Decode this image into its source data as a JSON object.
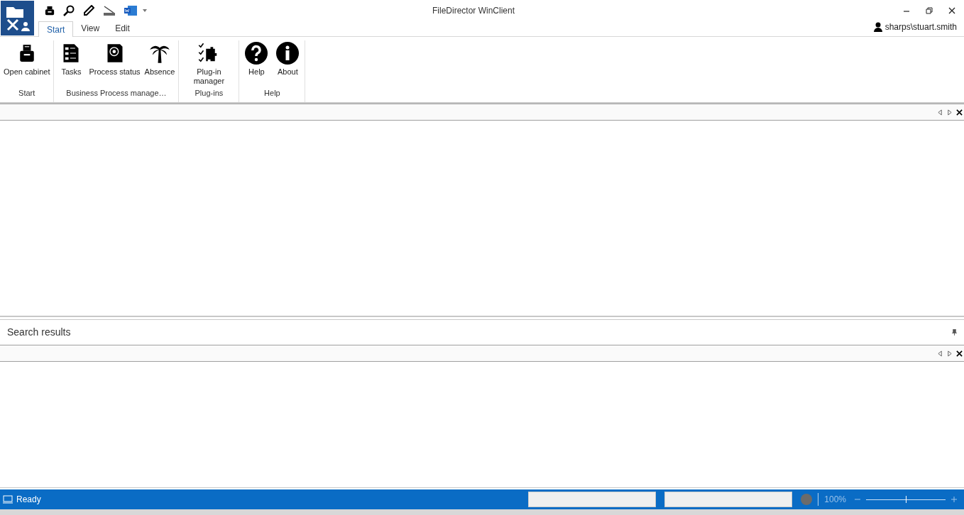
{
  "window": {
    "title": "FileDirector WinClient"
  },
  "tabs": [
    {
      "label": "Start",
      "selected": true
    },
    {
      "label": "View",
      "selected": false
    },
    {
      "label": "Edit",
      "selected": false
    }
  ],
  "user": "sharps\\stuart.smith",
  "ribbon_groups": [
    {
      "label": "Start",
      "buttons": [
        {
          "label": "Open cabinet"
        }
      ]
    },
    {
      "label": "Business Process manage…",
      "buttons": [
        {
          "label": "Tasks"
        },
        {
          "label": "Process status"
        },
        {
          "label": "Absence"
        }
      ]
    },
    {
      "label": "Plug-ins",
      "buttons": [
        {
          "label": "Plug-in manager"
        }
      ]
    },
    {
      "label": "Help",
      "buttons": [
        {
          "label": "Help"
        },
        {
          "label": "About"
        }
      ]
    }
  ],
  "search_results": {
    "title": "Search results"
  },
  "status_bar": {
    "text": "Ready",
    "zoom": "100%",
    "zoom_slider": {
      "level": 0.5
    }
  }
}
